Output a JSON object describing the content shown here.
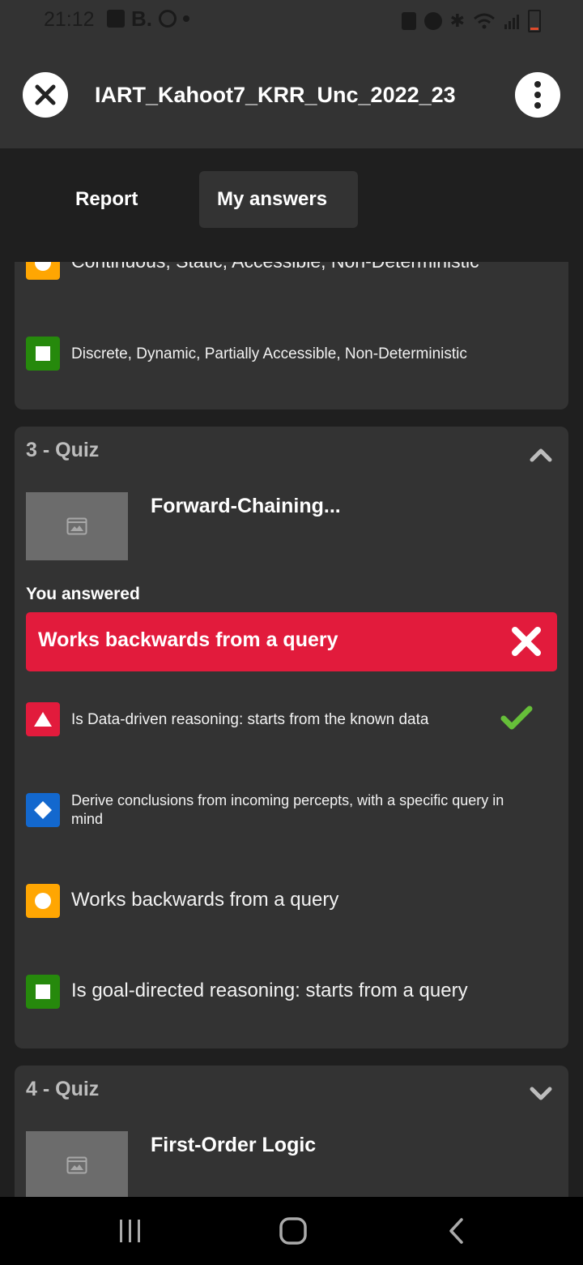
{
  "status_bar": {
    "time": "21:12",
    "left_icons": [
      "gallery-icon",
      "b-app-icon",
      "instagram-icon",
      "dot-icon"
    ],
    "right_icons": [
      "lock-icon",
      "alarm-icon",
      "bluetooth-icon",
      "wifi-icon",
      "signal-icon",
      "battery-icon"
    ]
  },
  "header": {
    "title": "IART_Kahoot7_KRR_Unc_2022_23"
  },
  "tabs": [
    {
      "label": "Report",
      "active": false
    },
    {
      "label": "My answers",
      "active": true
    }
  ],
  "previous_question": {
    "options": [
      {
        "shape": "circle",
        "color": "#ffa602",
        "text": "Continuous, Static, Accessible, Non-Deterministic"
      },
      {
        "shape": "square",
        "color": "#26890c",
        "text": "Discrete, Dynamic, Partially Accessible, Non-Deterministic"
      }
    ]
  },
  "question_3": {
    "header": "3 - Quiz",
    "expanded": true,
    "title": "Forward-Chaining...",
    "answered_label": "You answered",
    "answered_value": "Works backwards from a query",
    "answered_correct": false,
    "options": [
      {
        "shape": "triangle",
        "color": "#e21b3c",
        "text": "Is Data-driven reasoning: starts from the known data",
        "correct": true
      },
      {
        "shape": "diamond",
        "color": "#1368ce",
        "text": "Derive conclusions from incoming percepts, with a specific query in mind",
        "correct": false
      },
      {
        "shape": "circle",
        "color": "#ffa602",
        "text": "Works backwards from a query",
        "correct": false
      },
      {
        "shape": "square",
        "color": "#26890c",
        "text": "Is goal-directed reasoning: starts from a query",
        "correct": false
      }
    ]
  },
  "question_4": {
    "header": "4 - Quiz",
    "expanded": false,
    "title": "First-Order Logic"
  },
  "nav_bar": {
    "icons": [
      "recent-apps-icon",
      "home-icon",
      "back-icon"
    ]
  },
  "colors": {
    "background": "#1f1f1f",
    "card": "#333333",
    "red": "#e21b3c",
    "blue": "#1368ce",
    "yellow": "#ffa602",
    "green": "#26890c",
    "check": "#66bf39"
  }
}
